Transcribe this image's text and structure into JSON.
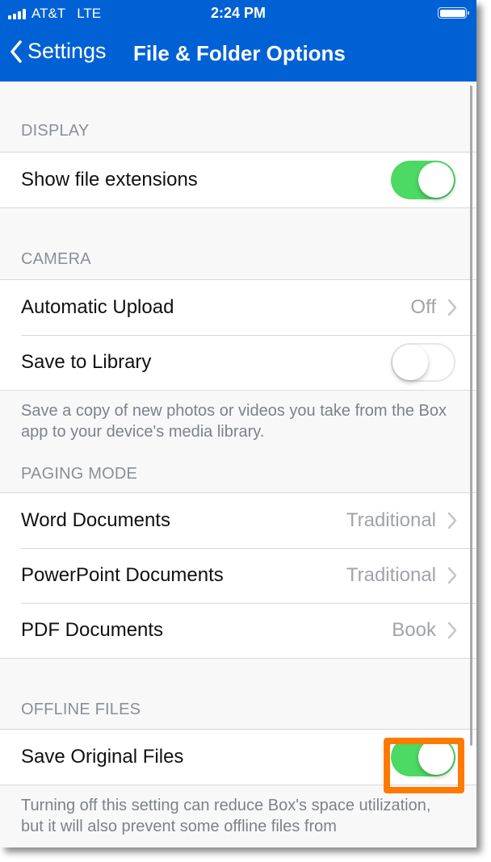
{
  "status_bar": {
    "carrier": "AT&T",
    "network": "LTE",
    "time": "2:24 PM",
    "signal_bars": 4,
    "battery_level": 1.0
  },
  "nav": {
    "back_label": "Settings",
    "title": "File & Folder Options"
  },
  "colors": {
    "header_bg": "#0061d5",
    "toggle_on": "#4cd964",
    "highlight": "#ff7a00"
  },
  "sections": [
    {
      "header": "DISPLAY",
      "rows": [
        {
          "label": "Show file extensions",
          "type": "toggle",
          "on": true
        }
      ]
    },
    {
      "header": "CAMERA",
      "rows": [
        {
          "label": "Automatic Upload",
          "type": "disclosure",
          "value": "Off"
        },
        {
          "label": "Save to Library",
          "type": "toggle",
          "on": false
        }
      ],
      "footer": "Save a copy of new photos or videos you take from the Box app to your device's media library."
    },
    {
      "header": "PAGING MODE",
      "rows": [
        {
          "label": "Word Documents",
          "type": "disclosure",
          "value": "Traditional"
        },
        {
          "label": "PowerPoint Documents",
          "type": "disclosure",
          "value": "Traditional"
        },
        {
          "label": "PDF Documents",
          "type": "disclosure",
          "value": "Book"
        }
      ]
    },
    {
      "header": "OFFLINE FILES",
      "rows": [
        {
          "label": "Save Original Files",
          "type": "toggle",
          "on": true,
          "highlighted": true
        }
      ],
      "footer": "Turning off this setting can reduce Box's space utilization, but it will also prevent some offline files from"
    }
  ]
}
